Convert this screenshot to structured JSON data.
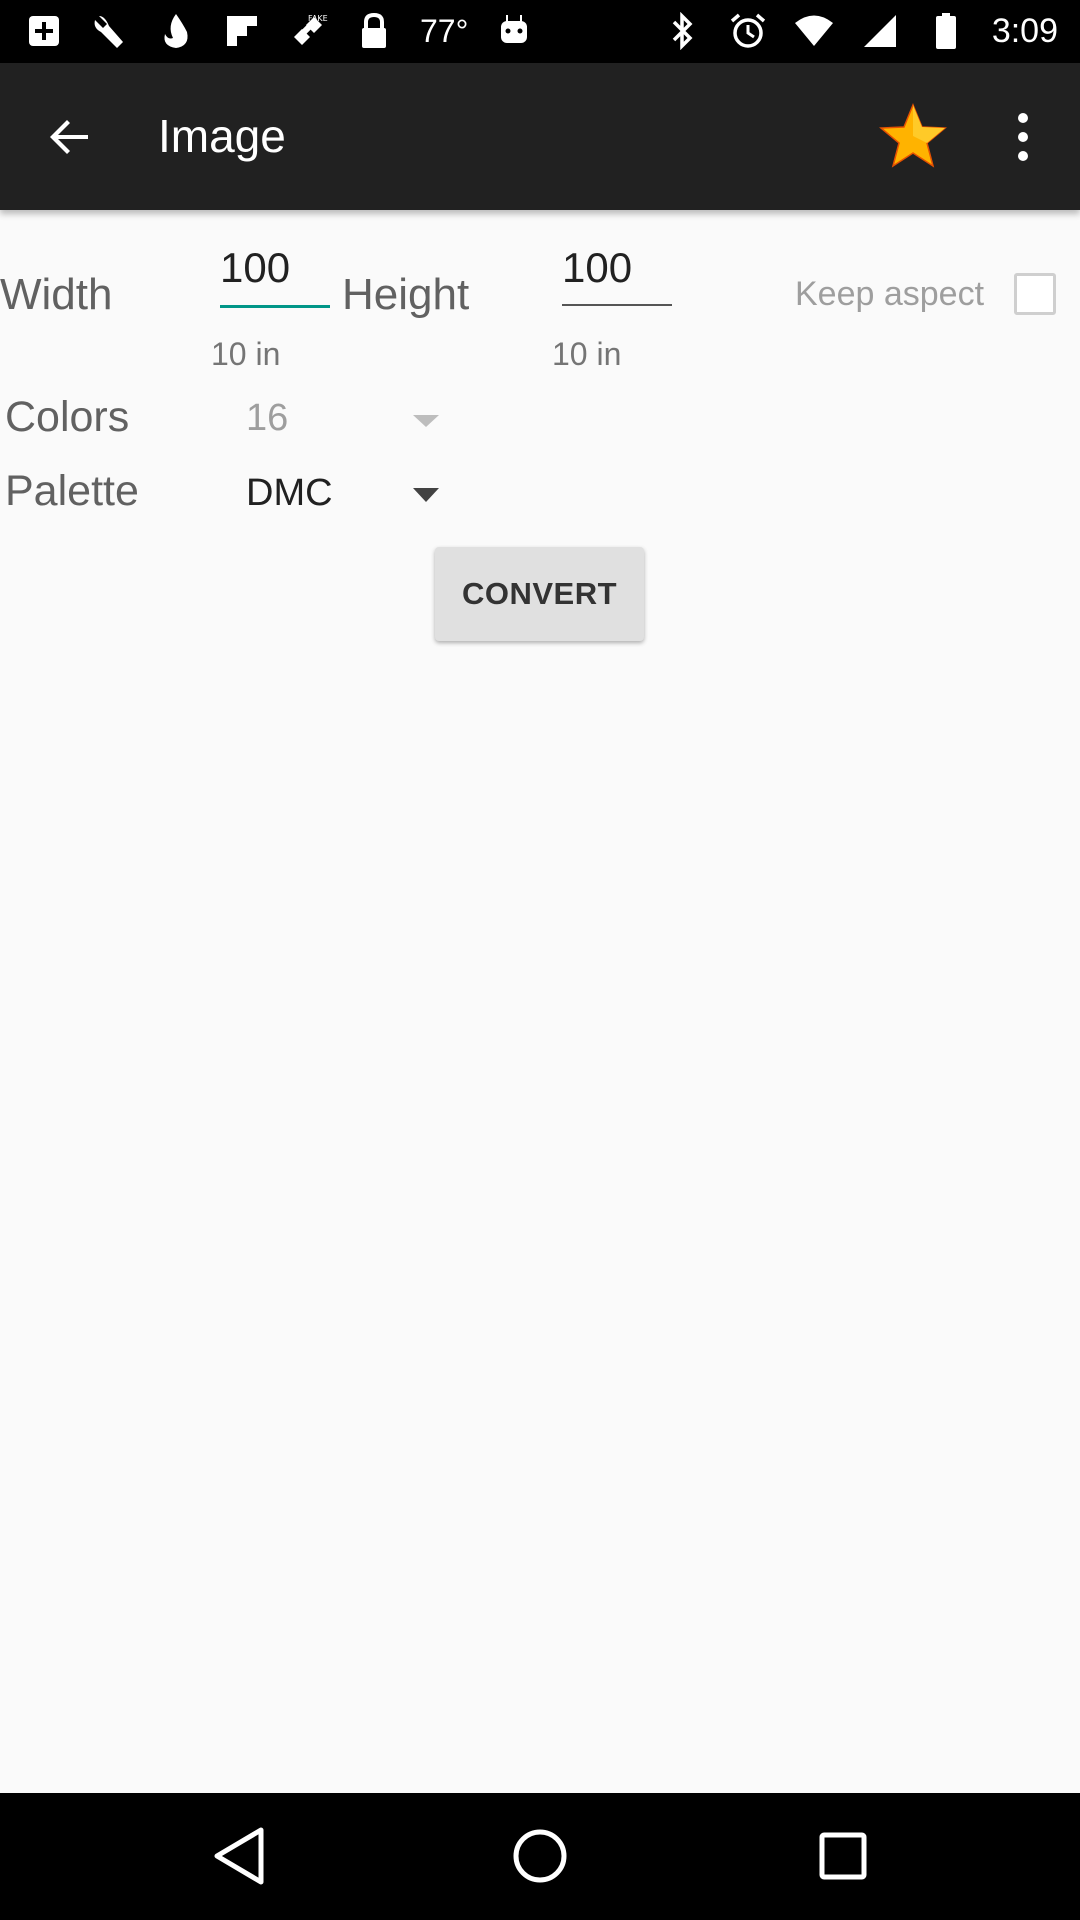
{
  "status_bar": {
    "temperature": "77°",
    "time": "3:09"
  },
  "app_bar": {
    "title": "Image"
  },
  "form": {
    "width_label": "Width",
    "width_value": "100",
    "width_inches": "10 in",
    "height_label": "Height",
    "height_value": "100",
    "height_inches": "10 in",
    "keep_aspect_label": "Keep aspect",
    "keep_aspect_checked": false,
    "colors_label": "Colors",
    "colors_value": "16",
    "palette_label": "Palette",
    "palette_value": "DMC"
  },
  "actions": {
    "convert_label": "CONVERT"
  },
  "colors": {
    "accent": "#009688",
    "app_bar": "#212121",
    "star": "#ffb300"
  }
}
